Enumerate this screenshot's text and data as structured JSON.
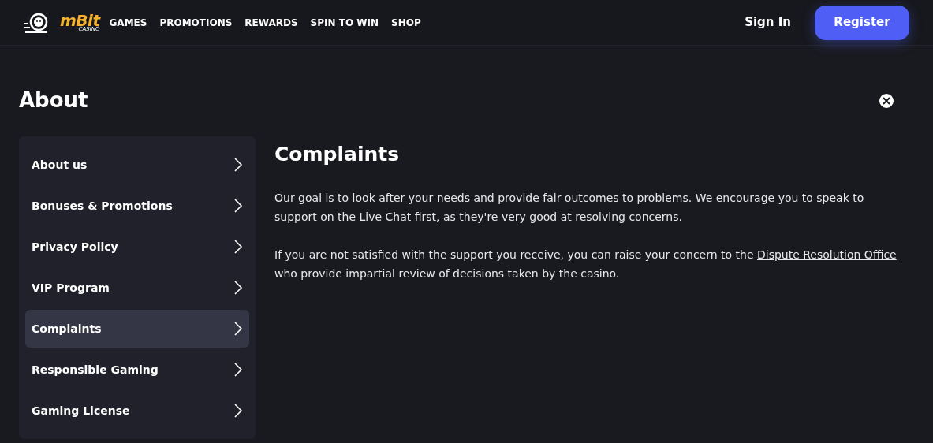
{
  "header": {
    "logo": {
      "brand": "mBit",
      "tagline": "CASINO"
    },
    "nav": [
      "GAMES",
      "PROMOTIONS",
      "REWARDS",
      "SPIN TO WIN",
      "SHOP"
    ],
    "sign_in": "Sign In",
    "register": "Register"
  },
  "page": {
    "title": "About"
  },
  "sidebar": {
    "items": [
      {
        "label": "About us",
        "selected": false
      },
      {
        "label": "Bonuses & Promotions",
        "selected": false
      },
      {
        "label": "Privacy Policy",
        "selected": false
      },
      {
        "label": "VIP Program",
        "selected": false
      },
      {
        "label": "Complaints",
        "selected": true
      },
      {
        "label": "Responsible Gaming",
        "selected": false
      },
      {
        "label": "Gaming License",
        "selected": false
      }
    ]
  },
  "content": {
    "heading": "Complaints",
    "paragraphs": [
      {
        "text": "Our goal is to look after your needs and provide fair outcomes to problems. We encourage you to speak to support on the Live Chat first, as they're very good at resolving concerns."
      },
      {
        "text": "If you are not satisfied with the support you receive, you can raise your concern to the",
        "link": "Dispute Resolution Office",
        "after": "who provide impartial review of decisions taken by the casino."
      }
    ]
  }
}
